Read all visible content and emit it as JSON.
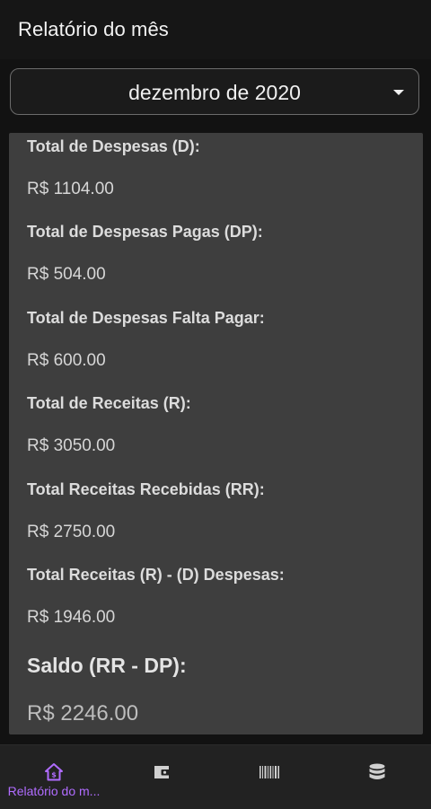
{
  "header": {
    "title": "Relatório do mês"
  },
  "month_selector": {
    "selected": "dezembro de 2020",
    "icon": "chevron-down-icon"
  },
  "report": {
    "rows": [
      {
        "label": "Total de Despesas (D):",
        "value": "R$ 1104.00"
      },
      {
        "label": "Total de Despesas Pagas (DP):",
        "value": "R$ 504.00"
      },
      {
        "label": "Total de Despesas Falta Pagar:",
        "value": "R$ 600.00"
      },
      {
        "label": "Total de Receitas (R):",
        "value": "R$ 3050.00"
      },
      {
        "label": "Total Receitas Recebidas (RR):",
        "value": "R$ 2750.00"
      },
      {
        "label": "Total Receitas (R) - (D) Despesas:",
        "value": "R$ 1946.00"
      }
    ],
    "saldo": {
      "label": "Saldo (RR - DP):",
      "value": "R$ 2246.00"
    }
  },
  "bottom_nav": {
    "items": [
      {
        "label": "Relatório do m...",
        "icon": "home-icon",
        "active": true
      },
      {
        "label": "",
        "icon": "wallet-icon",
        "active": false
      },
      {
        "label": "",
        "icon": "barcode-icon",
        "active": false
      },
      {
        "label": "",
        "icon": "database-icon",
        "active": false
      }
    ],
    "active_color": "#b06cff",
    "inactive_color": "#d0d0d0"
  }
}
